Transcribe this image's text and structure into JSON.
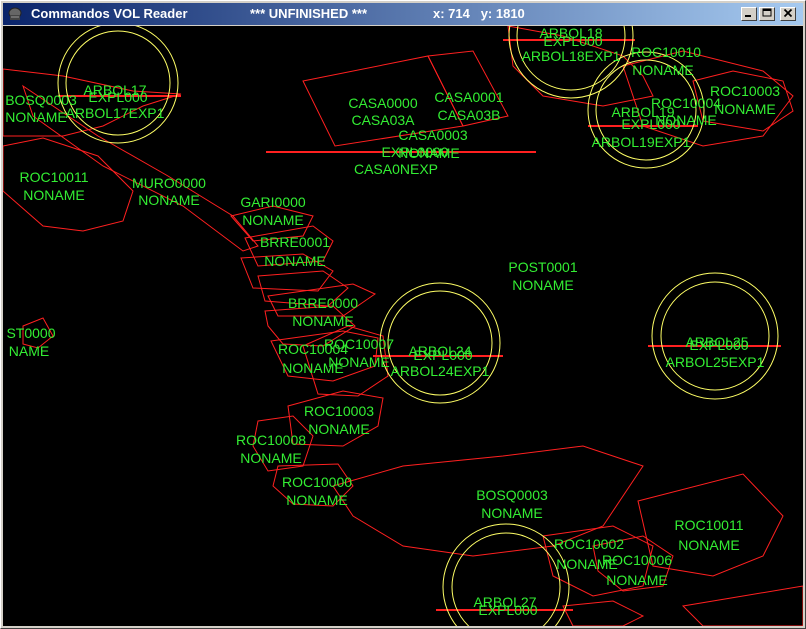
{
  "window": {
    "title": "Commandos VOL Reader",
    "status": "*** UNFINISHED ***",
    "coords": "x: 714   y: 1810",
    "icon": "commando-helmet-icon",
    "buttons": {
      "minimize": "minimize-icon",
      "maximize": "maximize-icon",
      "close": "close-icon"
    }
  },
  "colors": {
    "polygon": "#ff2020",
    "circle": "#ffff66",
    "label": "#33ee33",
    "background": "#000000"
  },
  "map": {
    "labels": [
      "ARBOL18",
      "EXPL000",
      "ARBOL18EXP1",
      "ROC10010",
      "NONAME",
      "ARBOL17",
      "EXPL000",
      "ARBOL17EXP1",
      "BOSQ0003",
      "NONAME",
      "CASA0000",
      "CASA03A",
      "CASA0001",
      "CASA03B",
      "CASA0003",
      "EXPL0000",
      "NONAME",
      "CASA0NEXP",
      "ROC10003",
      "NONAME",
      "ARBOL19",
      "EXPL000",
      "ARBOL19EXP1",
      "ROC10004",
      "NONAME",
      "ROC10011",
      "NONAME",
      "MURO0000",
      "NONAME",
      "GARI0000",
      "NONAME",
      "BRRE0001",
      "NONAME",
      "BRRE0000",
      "NONAME",
      "POST0001",
      "NONAME",
      "ST0000",
      "NAME",
      "ROC10007",
      "NONAME",
      "ROC10004",
      "NONAME",
      "ARBOL24",
      "EXPL000",
      "ARBOL24EXP1",
      "ARBOL25",
      "EXPL000",
      "ARBOL25EXP1",
      "ROC10003",
      "NONAME",
      "ROC10008",
      "NONAME",
      "ROC10000",
      "NONAME",
      "BOSQ0003",
      "NONAME",
      "ROC10011",
      "NONAME",
      "ROC10002",
      "NONAME",
      "ROC10006",
      "NONAME",
      "ARBOL27",
      "EXPL000"
    ]
  }
}
